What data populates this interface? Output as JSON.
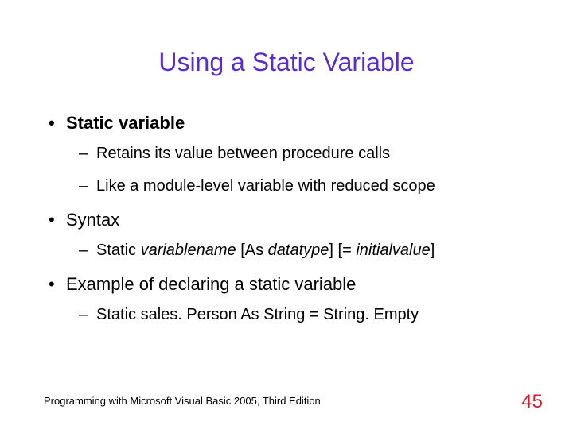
{
  "title": "Using a Static Variable",
  "bullets": {
    "b1": {
      "label": "Static variable"
    },
    "b1_subs": {
      "s1": "Retains its value between procedure calls",
      "s2": "Like a module-level variable with reduced scope"
    },
    "b2": {
      "label": "Syntax"
    },
    "b2_subs": {
      "s1_pre": "Static ",
      "s1_var": "variablename",
      "s1_mid1": " [As ",
      "s1_dt": "datatype",
      "s1_mid2": "] [= ",
      "s1_iv": "initialvalue",
      "s1_post": "]"
    },
    "b3": {
      "label": "Example of declaring a static variable"
    },
    "b3_subs": {
      "s1": "Static sales. Person As String = String. Empty"
    }
  },
  "footer": "Programming with Microsoft Visual Basic 2005, Third Edition",
  "page_number": "45",
  "glyphs": {
    "bullet": "•",
    "dash": "–"
  }
}
